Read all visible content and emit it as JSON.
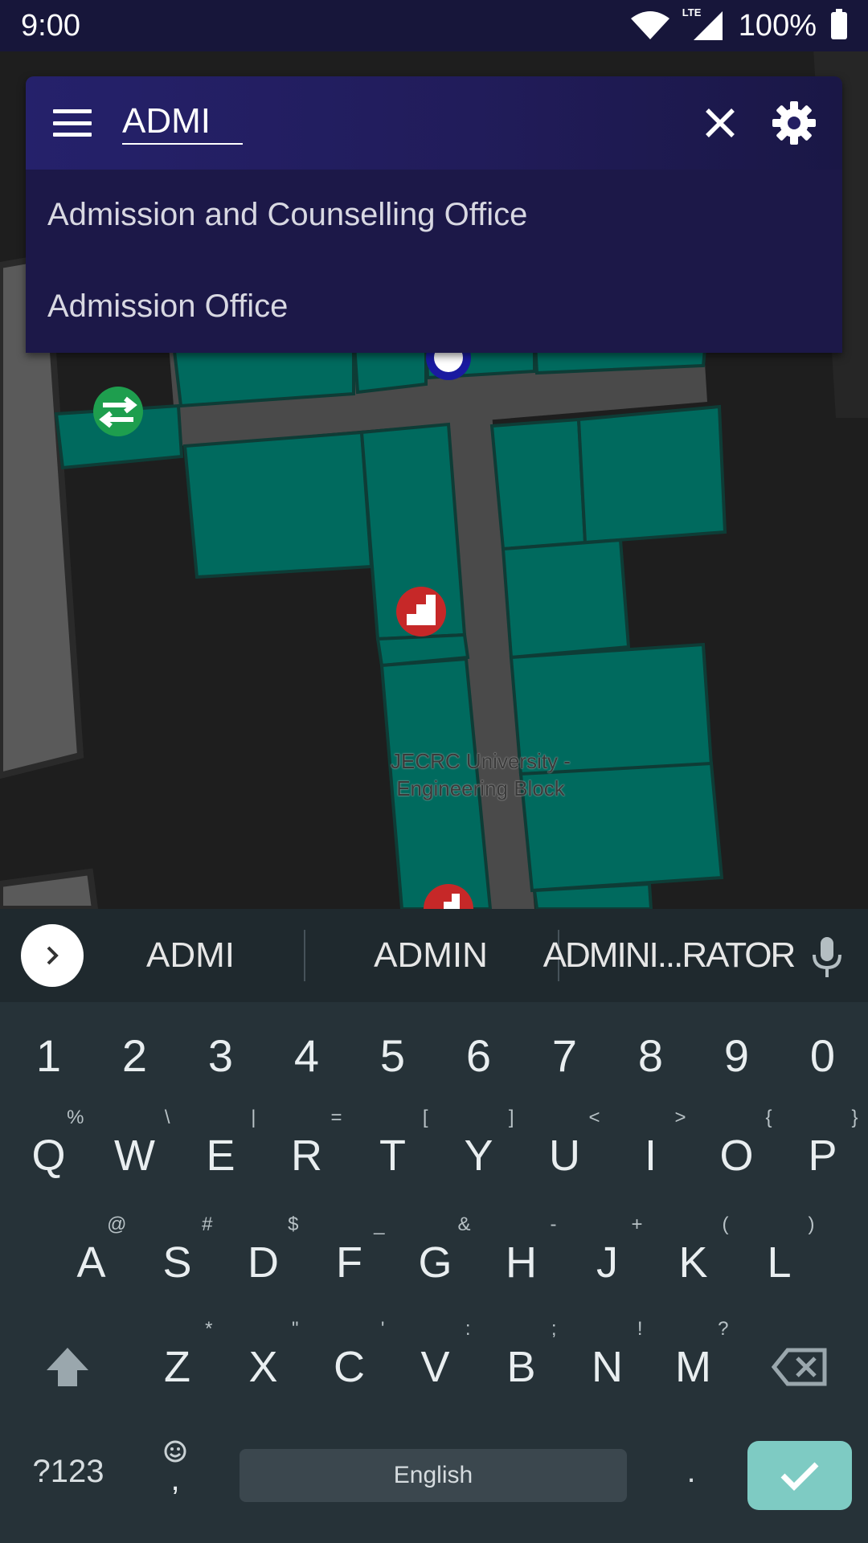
{
  "status_bar": {
    "time": "9:00",
    "network": "LTE",
    "battery": "100%",
    "icons": [
      "wifi-icon",
      "signal-icon",
      "battery-icon"
    ]
  },
  "map": {
    "label_line1": "JECRC University -",
    "label_line2": "Engineering Block",
    "colors": {
      "room": "#006a5e",
      "corridor": "#4a4a4a",
      "outside": "#1e1e1e",
      "neighbor_building": "#5a5a5a"
    },
    "markers": [
      "swap-direction-icon",
      "stairs-icon",
      "stairs-icon",
      "location-pin-icon"
    ]
  },
  "search": {
    "query": "ADMI",
    "suggestions": [
      "Admission and Counselling Office",
      "Admission Office"
    ],
    "icons": [
      "menu-icon",
      "close-icon",
      "gear-icon"
    ],
    "colors": {
      "bar": "#25216b",
      "dropdown": "#1c1848"
    }
  },
  "keyboard": {
    "suggestions": [
      "ADMI",
      "ADMIN",
      "ADMINI...RATOR"
    ],
    "numbers": [
      "1",
      "2",
      "3",
      "4",
      "5",
      "6",
      "7",
      "8",
      "9",
      "0"
    ],
    "row1": [
      {
        "key": "Q",
        "hint": "%"
      },
      {
        "key": "W",
        "hint": "\\"
      },
      {
        "key": "E",
        "hint": "|"
      },
      {
        "key": "R",
        "hint": "="
      },
      {
        "key": "T",
        "hint": "["
      },
      {
        "key": "Y",
        "hint": "]"
      },
      {
        "key": "U",
        "hint": "<"
      },
      {
        "key": "I",
        "hint": ">"
      },
      {
        "key": "O",
        "hint": "{"
      },
      {
        "key": "P",
        "hint": "}"
      }
    ],
    "row2": [
      {
        "key": "A",
        "hint": "@"
      },
      {
        "key": "S",
        "hint": "#"
      },
      {
        "key": "D",
        "hint": "$"
      },
      {
        "key": "F",
        "hint": "_"
      },
      {
        "key": "G",
        "hint": "&"
      },
      {
        "key": "H",
        "hint": "-"
      },
      {
        "key": "J",
        "hint": "+"
      },
      {
        "key": "K",
        "hint": "("
      },
      {
        "key": "L",
        "hint": ")"
      }
    ],
    "row3": [
      {
        "key": "Z",
        "hint": "*"
      },
      {
        "key": "X",
        "hint": "\""
      },
      {
        "key": "C",
        "hint": "'"
      },
      {
        "key": "V",
        "hint": ":"
      },
      {
        "key": "B",
        "hint": ";"
      },
      {
        "key": "N",
        "hint": "!"
      },
      {
        "key": "M",
        "hint": "?"
      }
    ],
    "symbols_key": "?123",
    "emoji_comma_key": ",",
    "space_label": "English",
    "period_key": ".",
    "colors": {
      "background": "#263238",
      "enter": "#7ecbc3"
    }
  }
}
